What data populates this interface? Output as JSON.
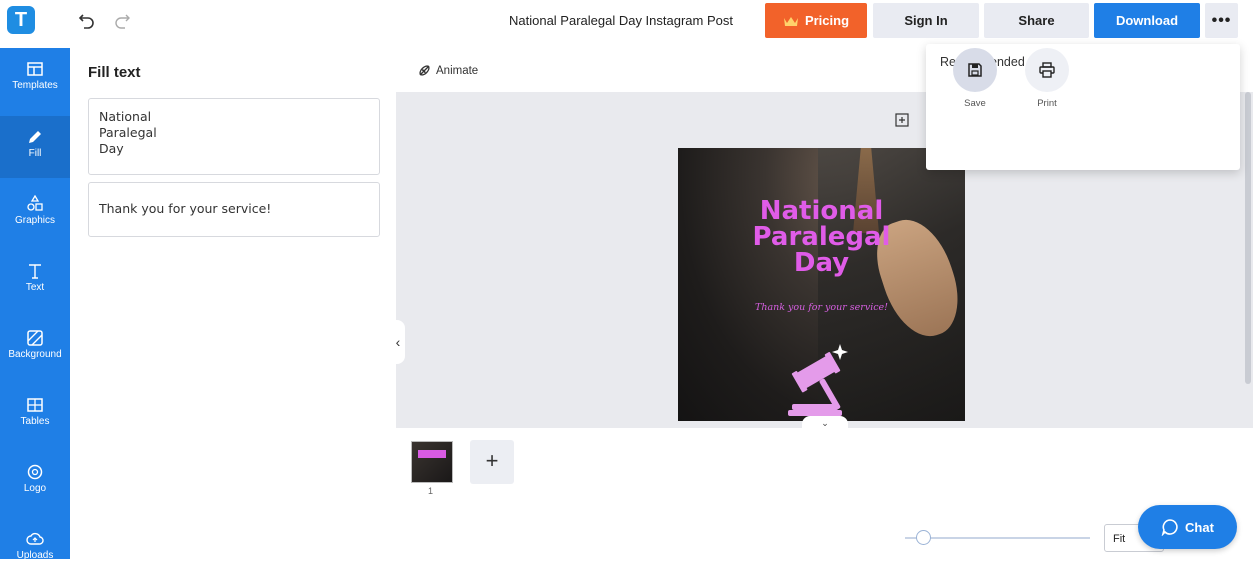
{
  "header": {
    "logo_letter": "T",
    "document_title": "National Paralegal Day Instagram Post",
    "pricing_label": "Pricing",
    "signin_label": "Sign In",
    "share_label": "Share",
    "download_label": "Download",
    "more_label": "•••",
    "brand_color": "#1f7fe6",
    "pricing_color": "#f2622a"
  },
  "sidebar": {
    "items": [
      {
        "label": "Templates",
        "icon": "templates-icon"
      },
      {
        "label": "Fill",
        "icon": "pencil-icon",
        "active": true
      },
      {
        "label": "Graphics",
        "icon": "shapes-icon"
      },
      {
        "label": "Text",
        "icon": "text-icon"
      },
      {
        "label": "Background",
        "icon": "background-icon"
      },
      {
        "label": "Tables",
        "icon": "table-icon"
      },
      {
        "label": "Logo",
        "icon": "logo-icon"
      },
      {
        "label": "Uploads",
        "icon": "upload-cloud-icon"
      }
    ]
  },
  "panel": {
    "title": "Fill text",
    "fields": [
      "National\nParalegal\nDay",
      "Thank you for your service!"
    ]
  },
  "canvas": {
    "animate_label": "Animate",
    "post_title": "National\nParalegal\nDay",
    "post_subtitle": "Thank you for your service!",
    "page_number": "1",
    "add_page_label": "+"
  },
  "zoom": {
    "fit_label": "Fit"
  },
  "chat": {
    "label": "Chat"
  },
  "dropdown": {
    "title": "Recommended",
    "options": [
      {
        "label": "Save",
        "icon": "save-icon"
      },
      {
        "label": "Print",
        "icon": "print-icon"
      }
    ]
  }
}
